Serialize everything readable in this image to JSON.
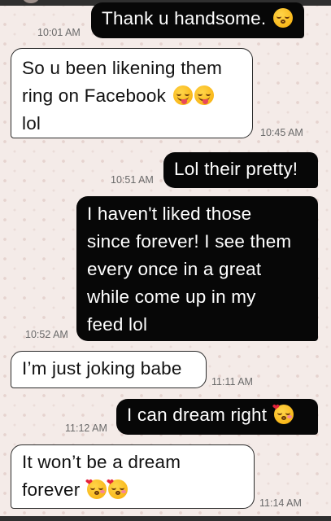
{
  "messages": [
    {
      "direction": "out",
      "text": "Thank u handsome.",
      "emoji": "kissing-closed-eyes",
      "time": "10:01 AM"
    },
    {
      "direction": "in",
      "lines": [
        "So u been likening them",
        "ring on Facebook",
        "lol"
      ],
      "emoji": "winking-tongue",
      "time": "10:45 AM"
    },
    {
      "direction": "out",
      "text": "Lol their pretty!",
      "time": "10:51 AM"
    },
    {
      "direction": "out",
      "lines": [
        "I haven't liked those",
        "since forever! I see them",
        "every once in a great",
        "while come up in my",
        "feed lol"
      ],
      "time": "10:52 AM"
    },
    {
      "direction": "in",
      "text": "I’m just joking babe",
      "time": "11:11 AM"
    },
    {
      "direction": "out",
      "text": "I can dream right",
      "emoji": "face-blowing-kiss",
      "time": "11:12 AM"
    },
    {
      "direction": "in",
      "lines": [
        "It won’t be a dream",
        "forever"
      ],
      "emoji": "face-blowing-kiss",
      "time": "11:14 AM"
    }
  ],
  "colors": {
    "outgoing_bubble": "#070707",
    "incoming_bubble": "#ffffff",
    "background": "#f4ebe8",
    "timestamp": "#6a6a6a"
  }
}
